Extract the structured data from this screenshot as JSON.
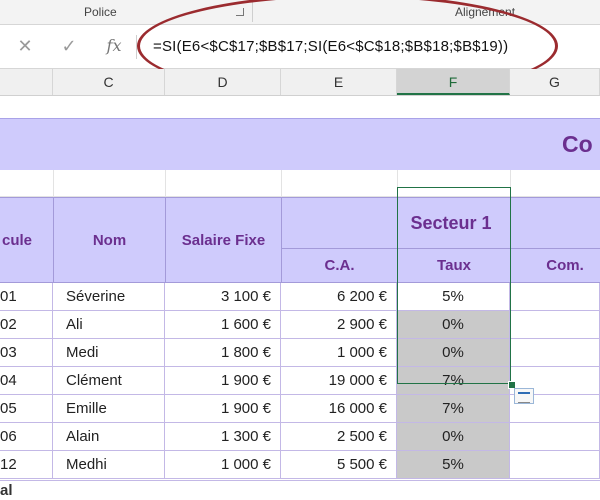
{
  "ribbon": {
    "groups": [
      "Police",
      "Alignement"
    ]
  },
  "formula_bar": {
    "icons": [
      "close-icon",
      "check-icon",
      "fx-icon"
    ],
    "fx_label": "fx",
    "formula": "=SI(E6<$C$17;$B$17;SI(E6<$C$18;$B$18;$B$19))"
  },
  "columns": [
    "C",
    "D",
    "E",
    "F",
    "G"
  ],
  "selected_column": "F",
  "table": {
    "title_fragment": "Co",
    "headers": {
      "matricule": "cule",
      "nom": "Nom",
      "salaire": "Salaire Fixe",
      "secteur": "Secteur 1",
      "ca": "C.A.",
      "taux": "Taux",
      "com": "Com."
    },
    "rows": [
      {
        "id": "01",
        "nom": "Séverine",
        "salaire": "3 100 €",
        "ca": "6 200 €",
        "taux": "5%",
        "com": ""
      },
      {
        "id": "02",
        "nom": "Ali",
        "salaire": "1 600 €",
        "ca": "2 900 €",
        "taux": "0%",
        "com": ""
      },
      {
        "id": "03",
        "nom": "Medi",
        "salaire": "1 800 €",
        "ca": "1 000 €",
        "taux": "0%",
        "com": ""
      },
      {
        "id": "04",
        "nom": "Clément",
        "salaire": "1 900 €",
        "ca": "19 000 €",
        "taux": "7%",
        "com": ""
      },
      {
        "id": "05",
        "nom": "Emille",
        "salaire": "1 900 €",
        "ca": "16 000 €",
        "taux": "7%",
        "com": ""
      },
      {
        "id": "06",
        "nom": "Alain",
        "salaire": "1 300 €",
        "ca": "2 500 €",
        "taux": "0%",
        "com": ""
      },
      {
        "id": "12",
        "nom": "Medhi",
        "salaire": "1 000 €",
        "ca": "5 500 €",
        "taux": "5%",
        "com": ""
      }
    ],
    "total_fragment": "al"
  },
  "colors": {
    "header_fill": "#cfcbfc",
    "header_text": "#6b2f8f",
    "selection": "#217346",
    "annotation": "#9b2b2f",
    "selected_cells": "#c9c9c9"
  }
}
